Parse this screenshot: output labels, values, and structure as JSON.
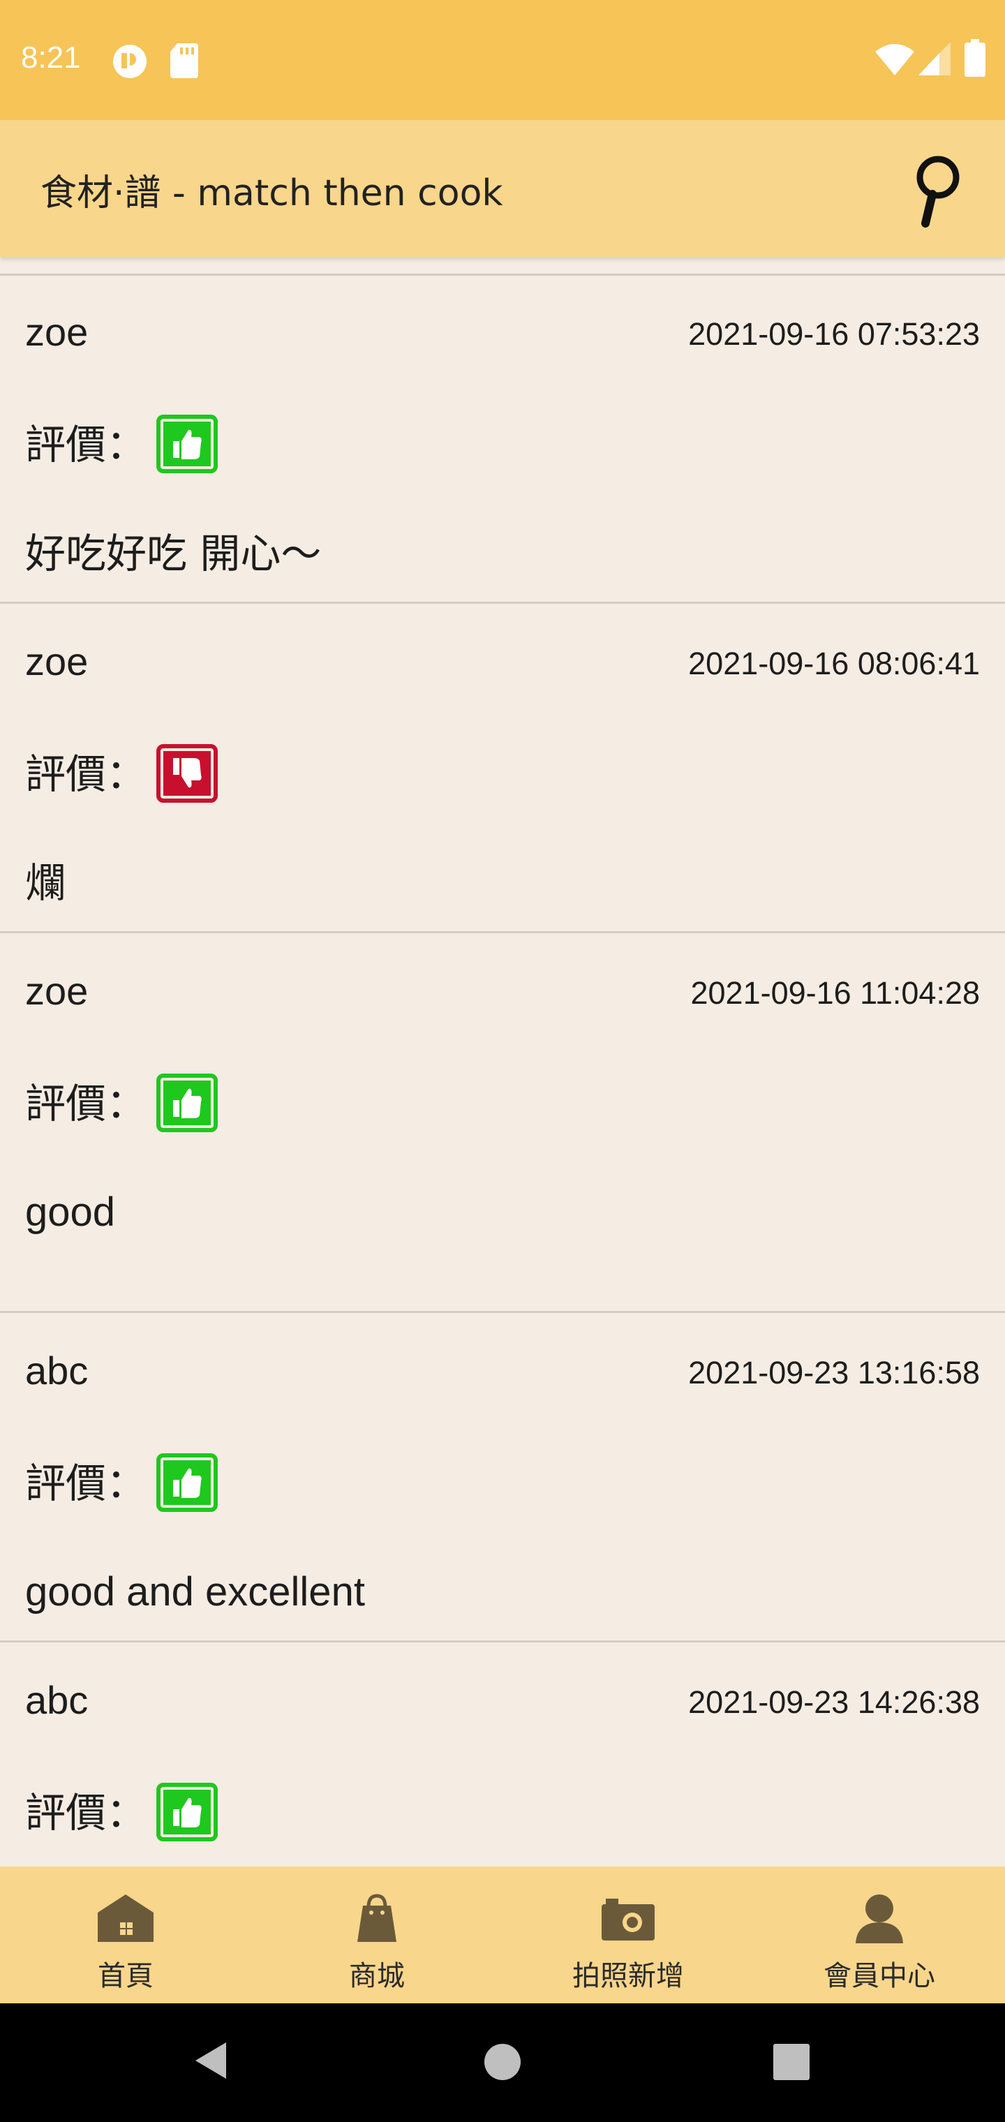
{
  "status_bar": {
    "time": "8:21",
    "icons": [
      "app-notification-icon",
      "sd-card-icon",
      "wifi-icon",
      "cellular-signal-icon",
      "battery-icon"
    ]
  },
  "app_bar": {
    "title": "食材·譜 - match then cook",
    "search_icon": "magnifier-icon"
  },
  "reviews": [
    {
      "author": "zoe",
      "date": "2021-09-16 07:53:23",
      "rating_label": "評價：",
      "rating": "thumbs-up",
      "comment": "好吃好吃 開心～"
    },
    {
      "author": "zoe",
      "date": "2021-09-16 08:06:41",
      "rating_label": "評價：",
      "rating": "thumbs-down",
      "comment": "爛"
    },
    {
      "author": "zoe",
      "date": "2021-09-16 11:04:28",
      "rating_label": "評價：",
      "rating": "thumbs-up",
      "comment": "good"
    },
    {
      "author": "abc",
      "date": "2021-09-23 13:16:58",
      "rating_label": "評價：",
      "rating": "thumbs-up",
      "comment": "good and excellent"
    },
    {
      "author": "abc",
      "date": "2021-09-23 14:26:38",
      "rating_label": "評價：",
      "rating": "thumbs-up",
      "comment": ""
    }
  ],
  "colors": {
    "status_bar": "#f6c457",
    "app_bar": "#f8d68b",
    "background": "#f5ece3",
    "thumbs_up": "#1ec81e",
    "thumbs_down": "#c8102e",
    "nav_icon": "#6b5a3a"
  },
  "bottom_nav": {
    "items": [
      {
        "label": "首頁",
        "icon": "home-icon"
      },
      {
        "label": "商城",
        "icon": "shopping-bag-icon"
      },
      {
        "label": "拍照新增",
        "icon": "camera-icon"
      },
      {
        "label": "會員中心",
        "icon": "member-icon"
      }
    ]
  },
  "system_nav": {
    "buttons": [
      "back-icon",
      "home-circle-icon",
      "recents-icon"
    ]
  }
}
